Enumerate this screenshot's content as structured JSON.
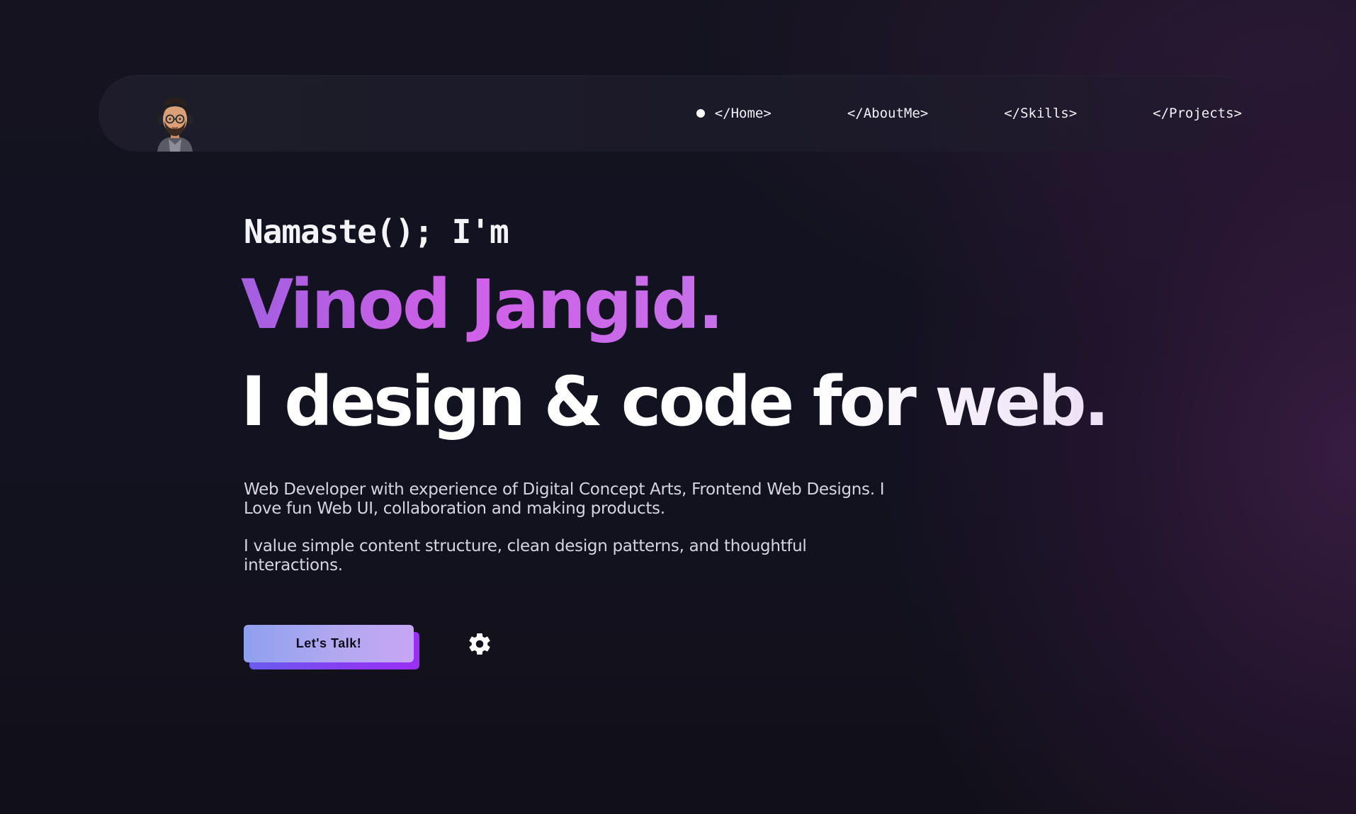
{
  "nav": {
    "avatar_icon": "avatar-memoji-icon",
    "items": [
      {
        "label": "</Home>",
        "active": true
      },
      {
        "label": "</AboutMe>"
      },
      {
        "label": "</Skills>"
      },
      {
        "label": "</Projects>"
      }
    ]
  },
  "hero": {
    "greeting": "Namaste(); I'm",
    "name": "Vinod Jangid.",
    "tagline": "I design & code for web.",
    "paragraph1": "Web Developer with experience of Digital Concept Arts, Frontend Web Designs. I Love fun Web UI, collaboration and making products.",
    "paragraph2": "I value simple content structure, clean design patterns, and thoughtful interactions."
  },
  "actions": {
    "cta_label": "Let's Talk!",
    "settings_icon": "gear-icon"
  },
  "colors": {
    "background": "#121220",
    "accent_purple": "#c466e8",
    "cta_gradient_start": "#8fa0ef",
    "cta_gradient_end": "#c6a6f5",
    "cta_shadow": "#8a3cf2"
  }
}
